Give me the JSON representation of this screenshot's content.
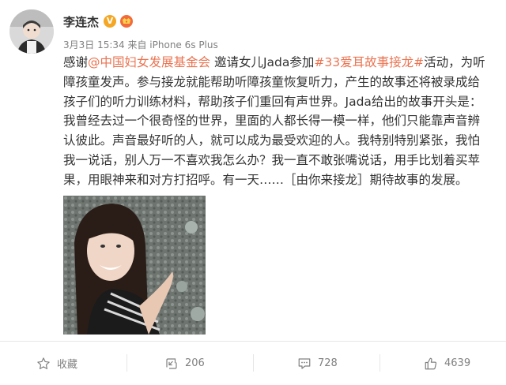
{
  "user": {
    "name": "李连杰",
    "verified_mark": "V",
    "meta": "3月3日 15:34 来自 iPhone 6s Plus"
  },
  "post": {
    "line1_a": "感谢",
    "line1_link1": "@中国妇女发展基金会",
    "line1_b": " 邀请女儿Jada参加",
    "line1_link2": "#33爱耳故事接龙#",
    "line1_c": "活动，为听",
    "line2": "障孩童发声。参与接龙就能帮助听障孩童恢复听力，产生的故事还将被录成给",
    "line3": "孩子们的听力训练材料，帮助孩子们重回有声世界。Jada给出的故事开头是：",
    "line4": "我曾经去过一个很奇怪的世界，里面的人都长得一模一样，他们只能靠声音辨",
    "line5": "认彼此。声音最好听的人，就可以成为最受欢迎的人。我特别特别紧张，我怕",
    "line6": "我一说话，别人万一不喜欢我怎么办？我一直不敢张嘴说话，用手比划着买苹",
    "line7": "果，用眼神来和对方打招呼。有一天……［由你来接龙］期待故事的发展。"
  },
  "actions": {
    "favorite": "收藏",
    "repost": "206",
    "comment": "728",
    "like": "4639"
  },
  "colors": {
    "link": "#eb7350",
    "text": "#333333",
    "meta": "#808080",
    "verified": "#f5a623"
  },
  "icons": [
    "star-icon",
    "repost-icon",
    "comment-icon",
    "like-icon",
    "vip-icon"
  ]
}
